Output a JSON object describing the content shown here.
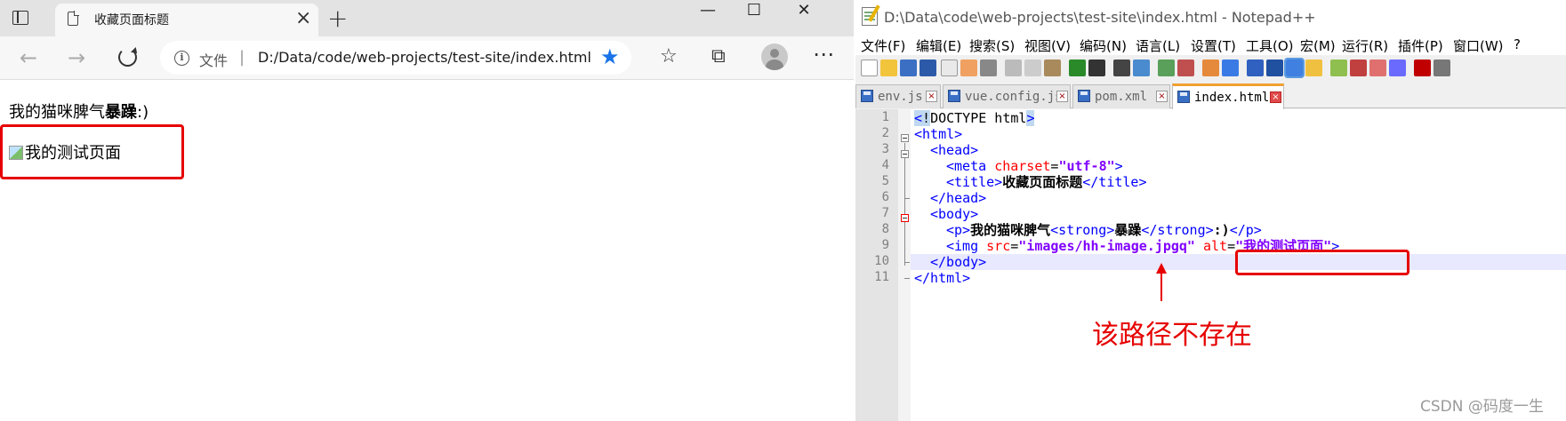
{
  "browser": {
    "tab_title": "收藏页面标题",
    "tab_close": "×",
    "new_tab": "+",
    "window_controls": {
      "minimize": "—",
      "maximize": "☐",
      "close": "✕"
    },
    "address": {
      "label": "文件",
      "separator": "|",
      "url": "D:/Data/code/web-projects/test-site/index.html"
    },
    "page": {
      "paragraph_plain": "我的猫咪脾气",
      "paragraph_strong": "暴躁",
      "paragraph_tail": ":)",
      "img_alt": "我的测试页面"
    }
  },
  "notepad": {
    "title": "D:\\Data\\code\\web-projects\\test-site\\index.html - Notepad++",
    "menu": [
      "文件(F)",
      "编辑(E)",
      "搜索(S)",
      "视图(V)",
      "编码(N)",
      "语言(L)",
      "设置(T)",
      "工具(O)",
      "宏(M)",
      "运行(R)",
      "插件(P)",
      "窗口(W)",
      "?"
    ],
    "tabs": [
      "env.js",
      "vue.config.js",
      "pom.xml",
      "index.html"
    ],
    "active_tab": "index.html",
    "line_numbers": [
      "1",
      "2",
      "3",
      "4",
      "5",
      "6",
      "7",
      "8",
      "9",
      "10",
      "11"
    ],
    "code": {
      "l1_a": "<",
      "l1_b": "!",
      "l1_c": "DOCTYPE html",
      "l1_d": ">",
      "l2": "<html>",
      "l3": "<head>",
      "l4_tag": "<meta",
      "l4_attr": "charset",
      "l4_eq": "=",
      "l4_val": "\"utf-8\"",
      "l4_end": ">",
      "l5_open": "<title>",
      "l5_text": "收藏页面标题",
      "l5_close": "</title>",
      "l6": "</head>",
      "l7": "<body>",
      "l8_p": "<p>",
      "l8_text": "我的猫咪脾气",
      "l8_strong": "<strong>",
      "l8_strong_text": "暴躁",
      "l8_strong_close": "</strong>",
      "l8_tail": ":)",
      "l8_pclose": "</p>",
      "l9_tag": "<img",
      "l9_src": "src",
      "l9_eq": "=",
      "l9_srcval": "\"images/hh-image.jpgq\"",
      "l9_alt": "alt",
      "l9_eq2": "=",
      "l9_altval": "\"我的测试页面\"",
      "l9_end": ">",
      "l10": "</body>",
      "l11": "</html>"
    }
  },
  "annotation": "该路径不存在",
  "watermark": "CSDN @码度一生"
}
